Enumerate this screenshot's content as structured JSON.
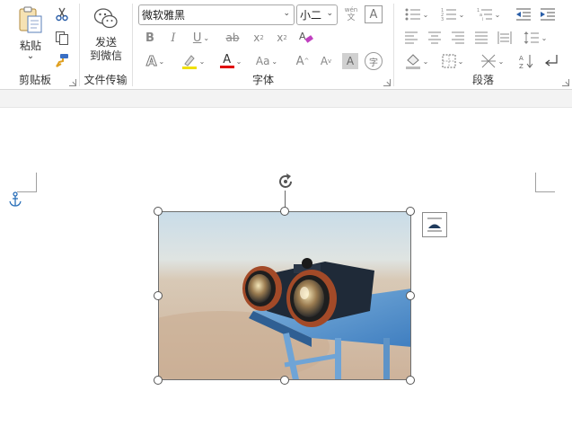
{
  "ribbon": {
    "clipboard": {
      "group_label": "剪贴板",
      "paste_label": "粘贴",
      "paste_caret": "⌄"
    },
    "file_transfer": {
      "group_label": "文件传输",
      "send_line1": "发送",
      "send_line2": "到微信"
    },
    "font": {
      "group_label": "字体",
      "font_name": "微软雅黑",
      "font_size": "小二",
      "pinyin_top": "wén",
      "pinyin_char": "文",
      "char_border": "A",
      "bold": "B",
      "italic": "I",
      "underline": "U",
      "strike": "ab",
      "subscript": "x",
      "sub_mark": "2",
      "superscript": "x",
      "sup_mark": "2",
      "text_effects": "A",
      "font_color": "A",
      "font_color_hex": "#e00000",
      "highlight_hex": "#f0e000",
      "change_case": "Aa",
      "grow_font": "A",
      "shrink_font": "A",
      "char_shading": "A",
      "enclose_char": "字"
    },
    "paragraph": {
      "group_label": "段落"
    }
  },
  "document": {
    "image_alt": "binoculars on a blue wooden bench by the beach"
  }
}
